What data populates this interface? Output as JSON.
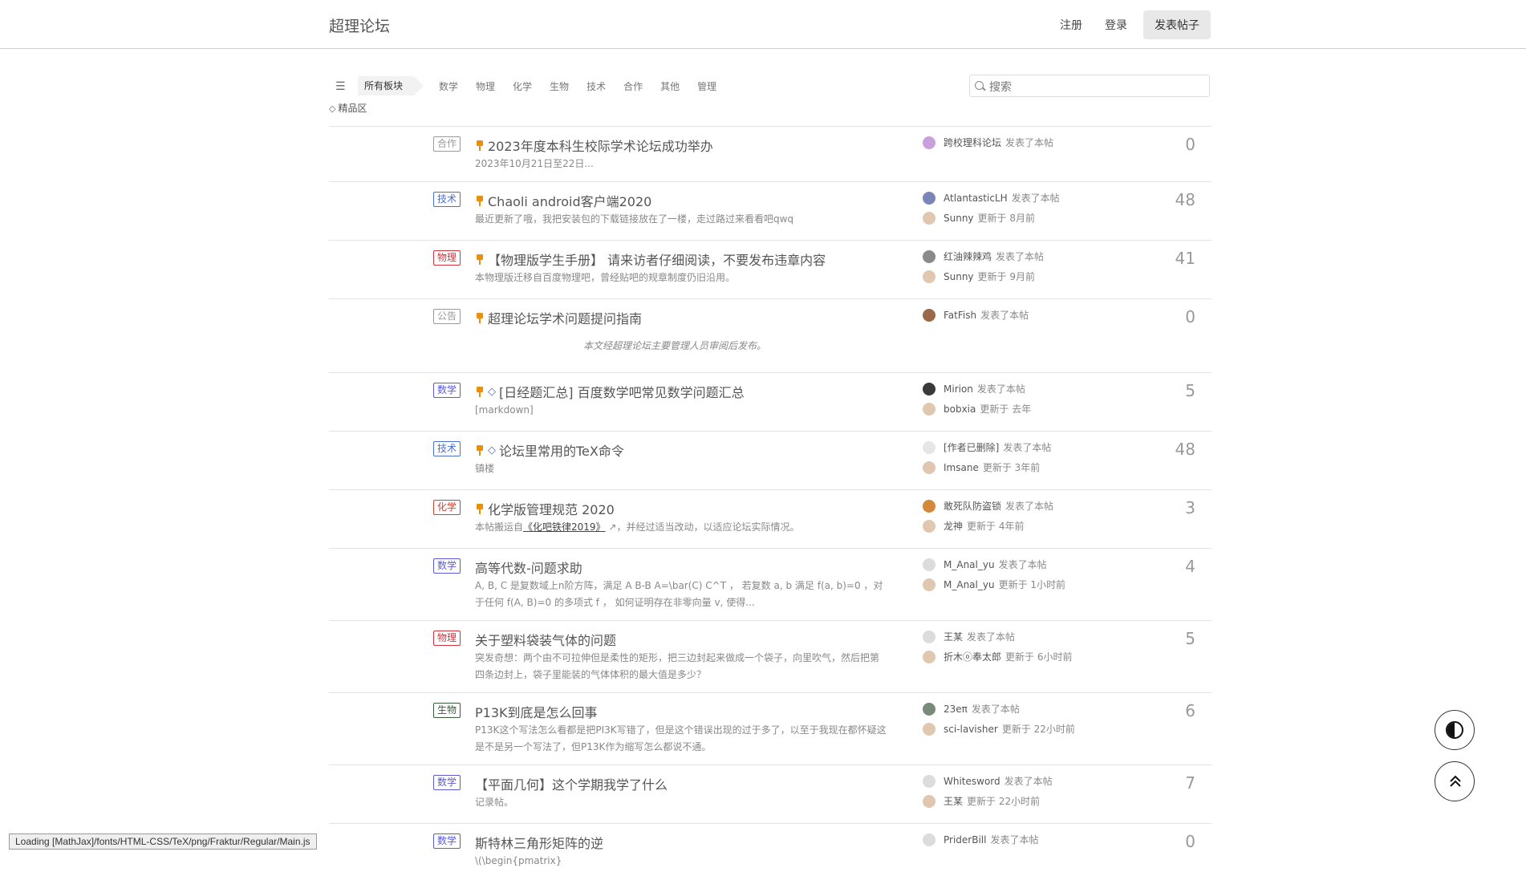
{
  "header": {
    "brand": "超理论坛",
    "register": "注册",
    "login": "登录",
    "post_button": "发表帖子"
  },
  "toolbar": {
    "breadcrumb": "所有板块",
    "categories": [
      "数学",
      "物理",
      "化学",
      "生物",
      "技术",
      "合作",
      "其他",
      "管理"
    ],
    "featured": "精品区",
    "search_placeholder": "搜索"
  },
  "colors": {
    "math": "#5b5bd6",
    "tech": "#4a6fd0",
    "physics": "#d0343c",
    "chemistry": "#d2412f",
    "biology": "#3a5a3a",
    "gray": "#9a9a9a",
    "pin": "#e8900c",
    "diamond": "#4a6fb8"
  },
  "threads": [
    {
      "tag": "合作",
      "tag_color": "#9a9a9a",
      "pinned": true,
      "featured": false,
      "title": "2023年度本科生校际学术论坛成功举办",
      "excerpt": "2023年10月21日至22日...",
      "author": "跨校理科论坛",
      "author_action": "发表了本帖",
      "last": "",
      "last_action": "",
      "count": "0"
    },
    {
      "tag": "技术",
      "tag_color": "#4a6fd0",
      "pinned": true,
      "featured": false,
      "title": "Chaoli android客户端2020",
      "excerpt": "最近更新了哦，我把安装包的下载链接放在了一楼，走过路过来看看吧qwq",
      "author": "AtlantasticLH",
      "author_action": "发表了本帖",
      "last": "Sunny",
      "last_action": "更新于 8月前",
      "count": "48"
    },
    {
      "tag": "物理",
      "tag_color": "#d0343c",
      "pinned": true,
      "featured": false,
      "title": "【物理版学生手册】 请来访者仔细阅读，不要发布违章内容",
      "excerpt": "本物理版迁移自百度物理吧，曾经贴吧的规章制度仍旧沿用。",
      "author": "红油辣辣鸡",
      "author_action": "发表了本帖",
      "last": "Sunny",
      "last_action": "更新于 9月前",
      "count": "41"
    },
    {
      "tag": "公告",
      "tag_color": "#9a9a9a",
      "pinned": true,
      "featured": false,
      "title": "超理论坛学术问题提问指南",
      "excerpt": "",
      "notice": "本文经超理论坛主要管理人员审阅后发布。",
      "author": "FatFish",
      "author_action": "发表了本帖",
      "last": "",
      "last_action": "",
      "count": "0"
    },
    {
      "tag": "数学",
      "tag_color": "#5b5bd6",
      "pinned": true,
      "featured": true,
      "title": "[日经题汇总] 百度数学吧常见数学问题汇总",
      "excerpt": "[markdown]",
      "author": "Mirion",
      "author_action": "发表了本帖",
      "last": "bobxia",
      "last_action": "更新于 去年",
      "count": "5"
    },
    {
      "tag": "技术",
      "tag_color": "#4a6fd0",
      "pinned": true,
      "featured": true,
      "title": "论坛里常用的TeX命令",
      "excerpt": "镇楼",
      "author": "[作者已删除]",
      "author_action": "发表了本帖",
      "last": "Imsane",
      "last_action": "更新于 3年前",
      "count": "48"
    },
    {
      "tag": "化学",
      "tag_color": "#d2412f",
      "pinned": true,
      "featured": false,
      "title": "化学版管理规范 2020",
      "excerpt_pre": "本帖搬运自",
      "excerpt_link": "《化吧铁律2019》",
      "excerpt_post": "，并经过适当改动，以适应论坛实际情况。",
      "author": "敢死队防盗锁",
      "author_action": "发表了本帖",
      "last": "龙神",
      "last_action": "更新于 4年前",
      "count": "3"
    },
    {
      "tag": "数学",
      "tag_color": "#5b5bd6",
      "pinned": false,
      "featured": false,
      "title": "高等代数-问题求助",
      "excerpt": "A, B, C 是复数域上n阶方阵，满足 A B-B A=\\bar(C) C^T ， 若复数 a, b 满足 f(a, b)=0 ，对于任何 f(A, B)=0 的多项式 f ， 如何证明存在非零向量 v, 使得...",
      "author": "M_Anal_yu",
      "author_action": "发表了本帖",
      "last": "M_Anal_yu",
      "last_action": "更新于 1小时前",
      "count": "4"
    },
    {
      "tag": "物理",
      "tag_color": "#d0343c",
      "pinned": false,
      "featured": false,
      "title": "关于塑料袋装气体的问题",
      "excerpt": "突发奇想：两个由不可拉伸但是柔性的矩形，把三边封起来做成一个袋子，向里吹气，然后把第四条边封上，袋子里能装的气体体积的最大值是多少？",
      "author": "王某",
      "author_action": "发表了本帖",
      "last": "折木ⓞ奉太郎",
      "last_action": "更新于 6小时前",
      "count": "5"
    },
    {
      "tag": "生物",
      "tag_color": "#3a5a3a",
      "pinned": false,
      "featured": false,
      "title": "P13K到底是怎么回事",
      "excerpt": "P13K这个写法怎么看都是把PI3K写错了，但是这个错误出现的过于多了，以至于我现在都怀疑这是不是另一个写法了，但P13K作为缩写怎么都说不通。",
      "author": "23eπ",
      "author_action": "发表了本帖",
      "last": "sci-lavisher",
      "last_action": "更新于 22小时前",
      "count": "6"
    },
    {
      "tag": "数学",
      "tag_color": "#5b5bd6",
      "pinned": false,
      "featured": false,
      "title": "【平面几何】这个学期我学了什么",
      "excerpt": "记录帖。",
      "author": "Whitesword",
      "author_action": "发表了本帖",
      "last": "王某",
      "last_action": "更新于 22小时前",
      "count": "7"
    },
    {
      "tag": "数学",
      "tag_color": "#5b5bd6",
      "pinned": false,
      "featured": false,
      "title": "斯特林三角形矩阵的逆",
      "excerpt": "\\(\\begin{pmatrix}",
      "author": "PriderBill",
      "author_action": "发表了本帖",
      "last": "",
      "last_action": "",
      "count": "0"
    }
  ],
  "status_bar": "Loading [MathJax]/fonts/HTML-CSS/TeX/png/Fraktur/Regular/Main.js",
  "icons": {
    "list": "list-icon",
    "search": "search-icon",
    "contrast": "contrast-icon",
    "to_top": "double-chevron-up-icon"
  }
}
